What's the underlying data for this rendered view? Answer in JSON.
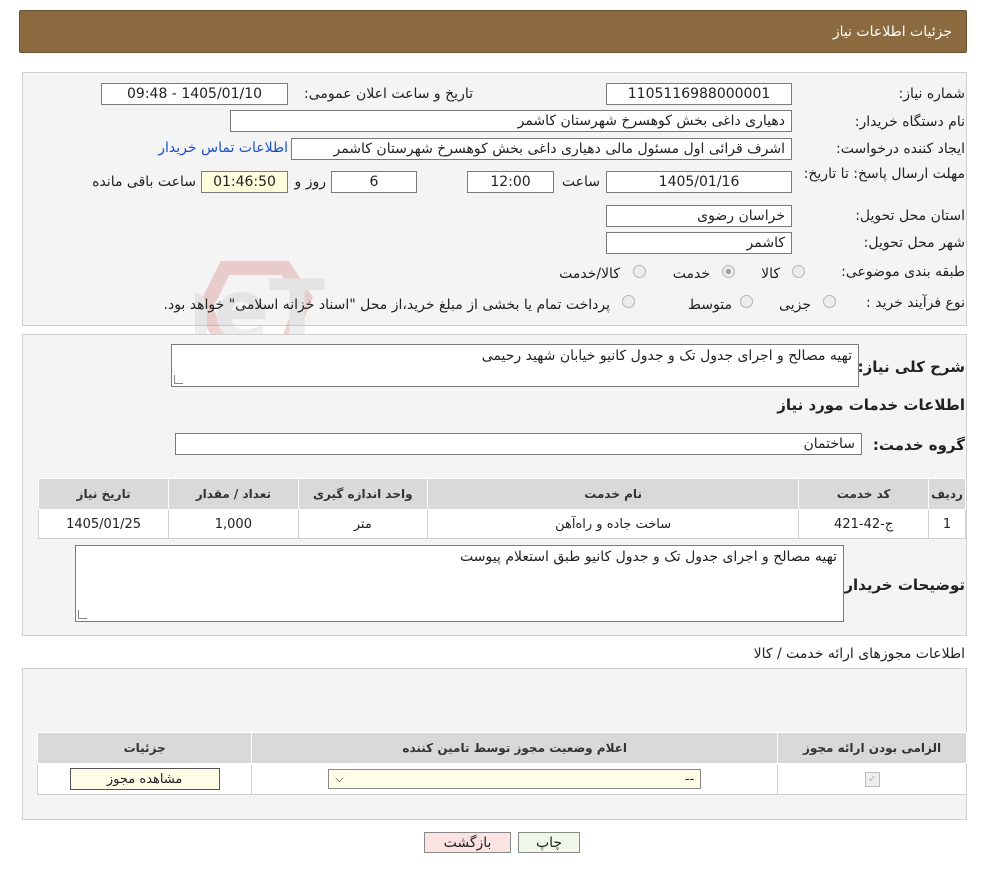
{
  "header": {
    "title": "جزئیات اطلاعات نیاز"
  },
  "watermark": {
    "text": "AriaTender.neT"
  },
  "form": {
    "need_number_label": "شماره نیاز:",
    "need_number": "1105116988000001",
    "announce_label": "تاریخ و ساعت اعلان عمومی:",
    "announce_value": "1405/01/10 - 09:48",
    "buyer_label": "نام دستگاه خریدار:",
    "buyer_value": "دهیاری داغی بخش کوهسرخ شهرستان کاشمر",
    "creator_label": "ایجاد کننده درخواست:",
    "creator_value": "اشرف قرائی اول مسئول مالی دهیاری داغی بخش کوهسرخ شهرستان کاشمر",
    "contact_link": "اطلاعات تماس خریدار",
    "deadline_label": "مهلت ارسال پاسخ: تا تاریخ:",
    "deadline_date": "1405/01/16",
    "time_label": "ساعت",
    "deadline_time": "12:00",
    "days_value": "6",
    "days_label": "روز و",
    "remaining_time": "01:46:50",
    "remaining_label": "ساعت باقی مانده",
    "province_label": "استان محل تحویل:",
    "province_value": "خراسان رضوی",
    "city_label": "شهر محل تحویل:",
    "city_value": "کاشمر",
    "category_label": "طبقه بندی موضوعی:",
    "category_options": [
      "کالا",
      "خدمت",
      "کالا/خدمت"
    ],
    "category_selected": "خدمت",
    "process_label": "نوع فرآیند خرید :",
    "process_options": [
      "جزیی",
      "متوسط"
    ],
    "process_note": "پرداخت تمام یا بخشی از مبلغ خرید،از محل \"اسناد خزانه اسلامی\" خواهد بود."
  },
  "details": {
    "summary_label": "شرح کلی نیاز:",
    "summary_value": "تهیه مصالح و اجرای جدول تک و جدول کانیو خیابان شهید رحیمی",
    "services_title": "اطلاعات خدمات مورد نیاز",
    "service_group_label": "گروه خدمت:",
    "service_group_value": "ساختمان",
    "table": {
      "headers": [
        "ردیف",
        "کد خدمت",
        "نام خدمت",
        "واحد اندازه گیری",
        "تعداد / مقدار",
        "تاریخ نیاز"
      ],
      "rows": [
        [
          "1",
          "ج-42-421",
          "ساخت جاده و راه‌آهن",
          "متر",
          "1,000",
          "1405/01/25"
        ]
      ]
    },
    "buyer_notes_label": "توضیحات خریدار:",
    "buyer_notes_value": "تهیه مصالح و اجرای جدول تک و جدول کانیو طبق استعلام پیوست"
  },
  "permits": {
    "title": "اطلاعات مجوزهای ارائه خدمت / کالا",
    "headers": [
      "الزامی بودن ارائه مجوز",
      "اعلام وضعیت مجوز توسط تامین کننده",
      "جزئیات"
    ],
    "select_value": "--",
    "view_button": "مشاهده مجوز"
  },
  "buttons": {
    "print": "چاپ",
    "back": "بازگشت"
  },
  "colors": {
    "header_bg": "#8b6a40",
    "link": "#1a4fc4",
    "back_button_bg": "#fbe3e3",
    "print_button_bg": "#eef7e8"
  }
}
